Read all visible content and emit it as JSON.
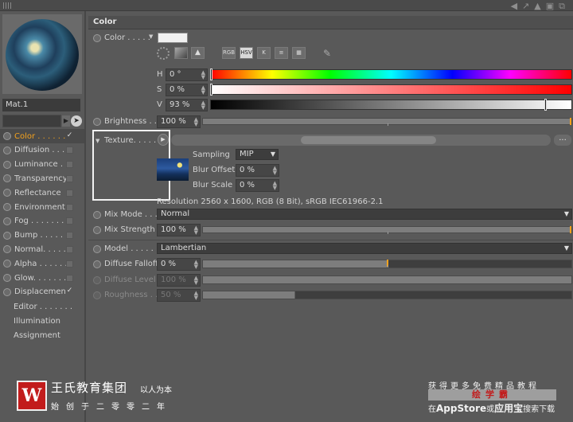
{
  "window": {
    "top_icons": [
      "play-back-icon",
      "arrow-icon",
      "lock-icon",
      "new-window-icon"
    ]
  },
  "material": {
    "name": "Mat.1"
  },
  "channels": [
    {
      "label": "Color . . . . . . .",
      "checked": true,
      "active": true
    },
    {
      "label": "Diffusion . . . . .",
      "checked": false
    },
    {
      "label": "Luminance . . . .",
      "checked": false
    },
    {
      "label": "Transparency",
      "checked": false
    },
    {
      "label": "Reflectance",
      "checked": false
    },
    {
      "label": "Environment",
      "checked": false
    },
    {
      "label": "Fog . . . . . . . . . .",
      "checked": false
    },
    {
      "label": "Bump . . . . . . . .",
      "checked": false
    },
    {
      "label": "Normal. . . . . . .",
      "checked": false
    },
    {
      "label": "Alpha . . . . . . . .",
      "checked": false
    },
    {
      "label": "Glow. . . . . . . . .",
      "checked": false
    },
    {
      "label": "Displacement",
      "checked": true
    }
  ],
  "plain_items": [
    "Editor . . . . . . .",
    "Illumination",
    "Assignment"
  ],
  "section": {
    "title": "Color"
  },
  "color": {
    "label": "Color . . . . .",
    "swatch": "#f0f0f0",
    "mode_buttons": [
      "RGB",
      "HSV",
      "K",
      "≡",
      "▦"
    ],
    "active_mode": "HSV",
    "h_label": "H",
    "h_value": "0 °",
    "s_label": "S",
    "s_value": "0 %",
    "v_label": "V",
    "v_value": "93 %",
    "h": 0,
    "s": 0,
    "v": 0.93
  },
  "brightness": {
    "label": "Brightness . . .",
    "value": "100 %",
    "level": 1.0
  },
  "texture": {
    "label": "Texture. . . . . .",
    "button_dots": "...",
    "sampling_label": "Sampling",
    "sampling_value": "MIP",
    "blur_offset_label": "Blur Offset",
    "blur_offset_value": "0 %",
    "blur_scale_label": "Blur Scale",
    "blur_scale_value": "0 %",
    "resolution": "Resolution 2560 x 1600, RGB (8 Bit), sRGB IEC61966-2.1"
  },
  "mix_mode": {
    "label": "Mix Mode . . .",
    "value": "Normal"
  },
  "mix_strength": {
    "label": "Mix Strength",
    "value": "100 %",
    "level": 1.0
  },
  "model": {
    "label": "Model . . . . .",
    "value": "Lambertian"
  },
  "diffuse_falloff": {
    "label": "Diffuse Falloff",
    "value": "0 %",
    "level": 0.0
  },
  "diffuse_level": {
    "label": "Diffuse Level",
    "value": "100 %",
    "level": 1.0
  },
  "roughness": {
    "label": "Roughness . . .",
    "value": "50 %",
    "level": 0.5
  },
  "watermark": {
    "logo_letter": "W",
    "brand": "王氏教育集团",
    "motto": "以人为本",
    "tagline": "始创于二零零二年",
    "promo_line1": "获得更多免费精品教程",
    "promo_line2": "绘学霸",
    "promo_line3_pre": "在",
    "promo_line3_app": "AppStore",
    "promo_line3_mid": "或",
    "promo_line3_store": "应用宝",
    "promo_line3_post": "搜索下载"
  },
  "accent": "#f4a21d"
}
